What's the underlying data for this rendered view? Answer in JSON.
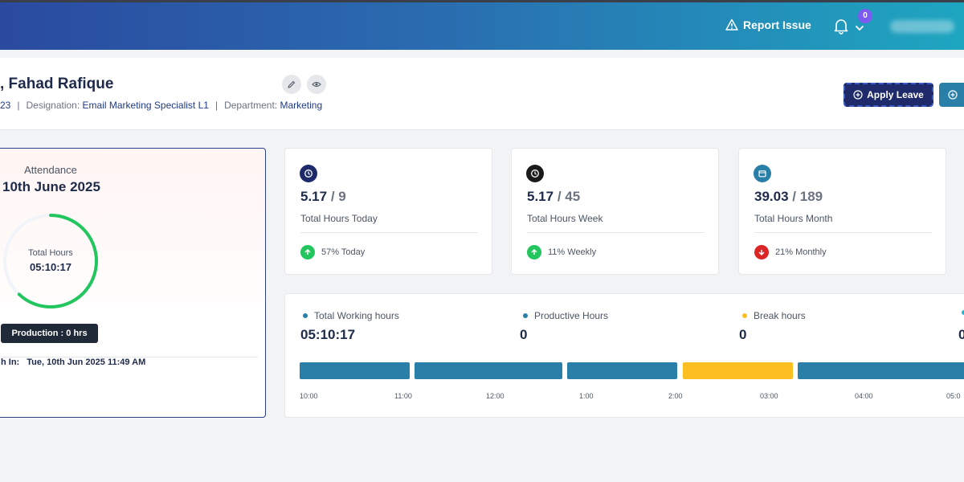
{
  "topbar": {
    "report_issue": "Report Issue",
    "notification_count": "0"
  },
  "header": {
    "name_partial": ", Fahad Rafique",
    "id_fragment": "23",
    "designation_label": "Designation:",
    "designation": "Email Marketing Specialist L1",
    "department_label": "Department:",
    "department": "Marketing",
    "apply_leave": "Apply Leave"
  },
  "attendance": {
    "label": "Attendance",
    "date_partial": "10th June 2025",
    "ring_label": "Total Hours",
    "ring_value": "05:10:17",
    "ring_progress": 0.62,
    "production": "Production : 0 hrs",
    "punch_label_partial": "h In:",
    "punch_value": "Tue, 10th Jun 2025 11:49 AM"
  },
  "stats": [
    {
      "value": "5.17",
      "of": "9",
      "label": "Total Hours Today",
      "trend": "57% Today",
      "direction": "up",
      "icon": "clock-icon",
      "icon_color": "#1f2a6b"
    },
    {
      "value": "5.17",
      "of": "45",
      "label": "Total Hours Week",
      "trend": "11% Weekly",
      "direction": "up",
      "icon": "clock-icon",
      "icon_color": "#1a1a1a"
    },
    {
      "value": "39.03",
      "of": "189",
      "label": "Total Hours Month",
      "trend": "21% Monthly",
      "direction": "down",
      "icon": "calendar-icon",
      "icon_color": "#2a7fa8"
    }
  ],
  "timeline": {
    "legend": [
      {
        "label": "Total Working hours",
        "value": "05:10:17",
        "color": "#2a7fa8"
      },
      {
        "label": "Productive Hours",
        "value": "0",
        "color": "#2a7fa8"
      },
      {
        "label": "Break hours",
        "value": "0",
        "color": "#fbbf24"
      },
      {
        "label": "",
        "value": "0",
        "color": "#22b6d4"
      }
    ],
    "ticks": [
      "10:00",
      "11:00",
      "12:00",
      "1:00",
      "2:00",
      "03:00",
      "04:00",
      "05:0"
    ]
  },
  "colors": {
    "primary": "#1f2a6b",
    "accent": "#2a7fa8",
    "break": "#fbbf24",
    "up": "#22c55e",
    "down": "#dc2626"
  }
}
